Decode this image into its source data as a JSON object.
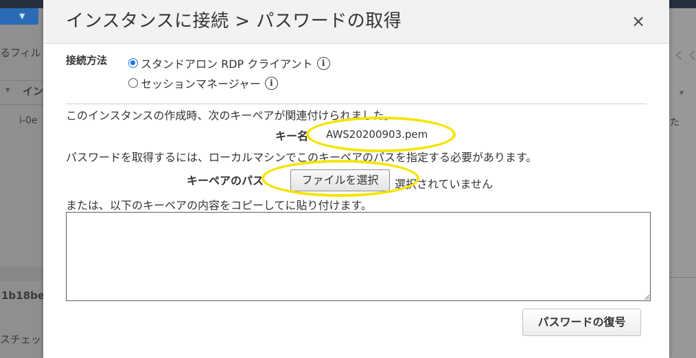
{
  "background": {
    "filter_text": "るフィル",
    "col_header": "イン",
    "instance_id": "i-0e",
    "id_fragment": "1b18be",
    "status_fragment": "スチェッ",
    "right_text": "た",
    "nav_arrows": "く く"
  },
  "modal": {
    "title": "インスタンスに接続 > パスワードの取得",
    "close_glyph": "×",
    "connection_method_label": "接続方法",
    "options": [
      {
        "label": "スタンドアロン RDP クライアント",
        "selected": true
      },
      {
        "label": "セッションマネージャー",
        "selected": false
      }
    ],
    "info_glyph": "i",
    "keypair_intro": "このインスタンスの作成時、次のキーペアが関連付けられました。",
    "key_name_label": "キー名",
    "key_name_value": "AWS20200903.pem",
    "path_instruction": "パスワードを取得するには、ローカルマシンでこのキーペアのパスを指定する必要があります。",
    "key_path_label": "キーペアのパス",
    "file_button_label": "ファイルを選択",
    "file_status": "選択されていません",
    "paste_instruction": "または、以下のキーペアの内容をコピーしてに貼り付けます。",
    "key_contents_value": "",
    "decrypt_button_label": "パスワードの復号"
  },
  "colors": {
    "highlight": "#f5e400",
    "radio_accent": "#1a73e8",
    "overlay": "#8f8f8f"
  }
}
